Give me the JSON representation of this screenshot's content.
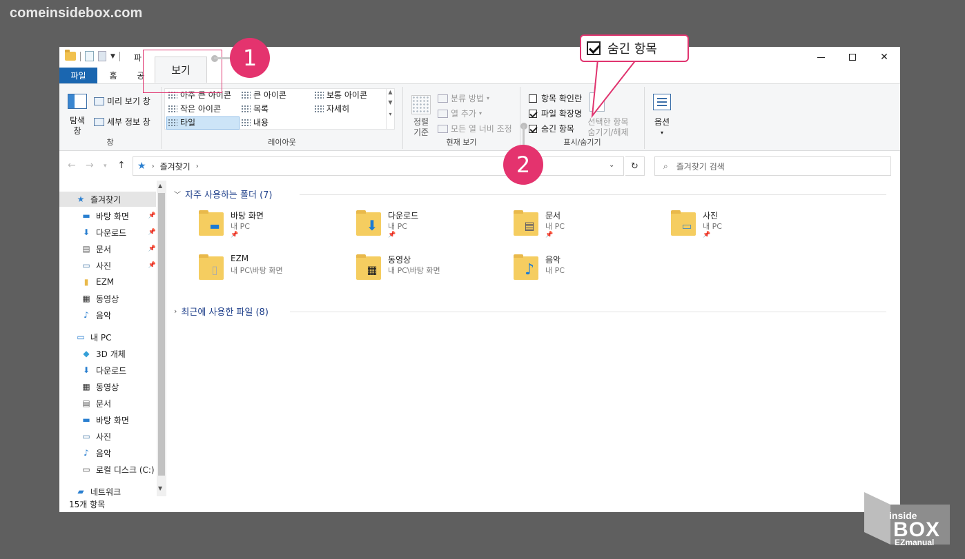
{
  "watermark": "comeinsidebox.com",
  "titlebar": {
    "title_partial": "파"
  },
  "tabs": {
    "file": "파일",
    "home": "홈",
    "share": "공",
    "view": "보기"
  },
  "ribbon": {
    "pane": {
      "nav_pane": "탐색\n창",
      "preview": "미리 보기 창",
      "details": "세부 정보 창",
      "group": "창"
    },
    "layout": {
      "items": [
        "아주 큰 아이콘",
        "큰 아이콘",
        "보통 아이콘",
        "작은 아이콘",
        "목록",
        "자세히",
        "타일",
        "내용"
      ],
      "group": "레이아웃"
    },
    "current": {
      "sort_by": "정렬\n기준",
      "group_by": "분류 방법",
      "add_cols": "열 추가",
      "fit_cols": "모든 열 너비 조정",
      "group": "현재 보기"
    },
    "showhide": {
      "item_checkboxes": "항목 확인란",
      "file_ext": "파일 확장명",
      "hidden_items": "숨긴 항목",
      "hide_selected": "선택한 항목\n숨기기/해제",
      "group": "표시/숨기기",
      "checked": {
        "item_checkboxes": false,
        "file_ext": true,
        "hidden_items": true
      }
    },
    "options": {
      "label": "옵션"
    }
  },
  "address": {
    "crumb": "즐겨찾기",
    "search_placeholder": "즐겨찾기 검색"
  },
  "navpane": {
    "quick": [
      {
        "label": "즐겨찾기",
        "icon": "star-icon",
        "pinned": false,
        "selected": true
      },
      {
        "label": "바탕 화면",
        "icon": "desktop-icon",
        "pinned": true
      },
      {
        "label": "다운로드",
        "icon": "download-icon",
        "pinned": true
      },
      {
        "label": "문서",
        "icon": "document-icon",
        "pinned": true
      },
      {
        "label": "사진",
        "icon": "picture-icon",
        "pinned": true
      },
      {
        "label": "EZM",
        "icon": "folder-icon",
        "pinned": false
      },
      {
        "label": "동영상",
        "icon": "video-icon",
        "pinned": false
      },
      {
        "label": "음악",
        "icon": "music-icon",
        "pinned": false
      }
    ],
    "pc": [
      {
        "label": "내 PC",
        "icon": "pc-icon"
      },
      {
        "label": "3D 개체",
        "icon": "cube-icon"
      },
      {
        "label": "다운로드",
        "icon": "download-icon"
      },
      {
        "label": "동영상",
        "icon": "video-icon"
      },
      {
        "label": "문서",
        "icon": "document-icon"
      },
      {
        "label": "바탕 화면",
        "icon": "desktop-icon"
      },
      {
        "label": "사진",
        "icon": "picture-icon"
      },
      {
        "label": "음악",
        "icon": "music-icon"
      },
      {
        "label": "로컬 디스크 (C:)",
        "icon": "drive-icon"
      },
      {
        "label": "네트워크",
        "icon": "network-icon"
      }
    ]
  },
  "content": {
    "frequent": "자주 사용하는 폴더 (7)",
    "recent": "최근에 사용한 파일 (8)",
    "folders": [
      {
        "name": "바탕 화면",
        "sub": "내 PC",
        "pinned": true,
        "overlay": "desktop"
      },
      {
        "name": "다운로드",
        "sub": "내 PC",
        "pinned": true,
        "overlay": "download"
      },
      {
        "name": "문서",
        "sub": "내 PC",
        "pinned": true,
        "overlay": "document"
      },
      {
        "name": "사진",
        "sub": "내 PC",
        "pinned": true,
        "overlay": "picture"
      },
      {
        "name": "EZM",
        "sub": "내 PC\\바탕 화면",
        "pinned": false,
        "overlay": "file"
      },
      {
        "name": "동영상",
        "sub": "내 PC\\바탕 화면",
        "pinned": false,
        "overlay": "video"
      },
      {
        "name": "음악",
        "sub": "내 PC",
        "pinned": false,
        "overlay": "music"
      }
    ]
  },
  "status": {
    "count": "15개 항목"
  },
  "annotations": {
    "badge1": "1",
    "badge2": "2",
    "callout": "숨긴 항목"
  },
  "brand": {
    "top": "inside",
    "main": "BOX",
    "sub": "EZmanual"
  },
  "colors": {
    "accent": "#e4336e",
    "ribbon_file": "#1a66b0",
    "folder": "#f5cd60"
  }
}
